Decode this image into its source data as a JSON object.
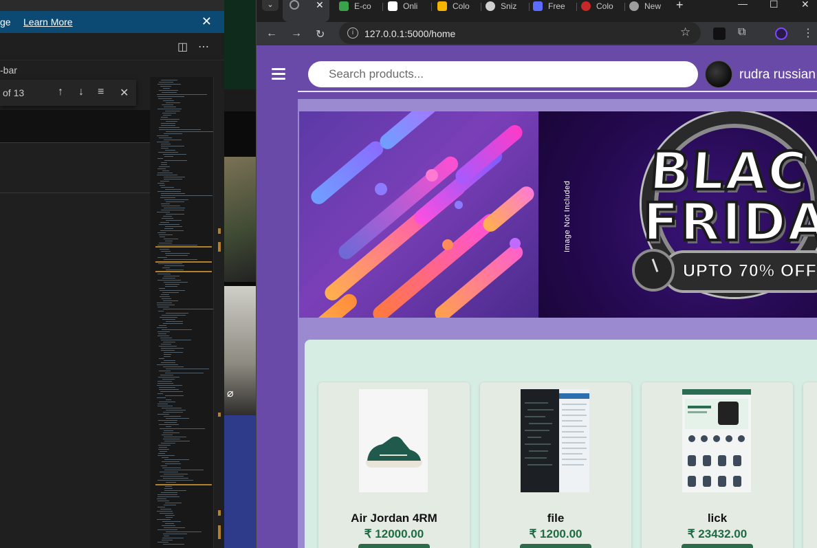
{
  "editor": {
    "notif_text": "ge",
    "learn_more": "Learn More",
    "close_glyph": "✕",
    "breadcrumb": "-bar",
    "find_count": "of 13"
  },
  "browser": {
    "tabs": [
      {
        "label": "E-co",
        "color": "#3aa24a"
      },
      {
        "label": "Onli",
        "color": "#ffffff"
      },
      {
        "label": "Colo",
        "color": "#f4b400"
      },
      {
        "label": "Sniz",
        "color": "#cfcfcf"
      },
      {
        "label": "Free",
        "color": "#5b6cff"
      },
      {
        "label": "Colo",
        "color": "#c62828"
      },
      {
        "label": "New",
        "color": "#9e9e9e"
      }
    ],
    "url": "127.0.0.1:5000/home"
  },
  "page": {
    "search_placeholder": "Search products...",
    "username": "rudra russian",
    "banner_alt": "Image Not Included",
    "banner_line1": "BLAC",
    "banner_line2": "FRIDA",
    "banner_offer": "UPTO 70% OFF",
    "products": [
      {
        "name": "Air Jordan 4RM",
        "price": "₹ 12000.00"
      },
      {
        "name": "file",
        "price": "₹ 1200.00"
      },
      {
        "name": "lick",
        "price": "₹ 23432.00"
      }
    ]
  },
  "colors": {
    "page_bg": "#6a4aa8",
    "hero_bg": "#9c8ad0",
    "products_bg": "#d6ede3",
    "price": "#1f6b44",
    "button": "#2f6b4a"
  }
}
